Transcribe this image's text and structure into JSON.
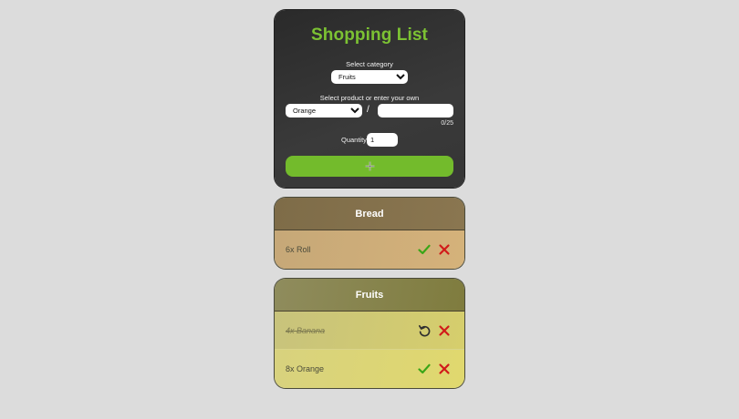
{
  "app": {
    "title": "Shopping List"
  },
  "form": {
    "category_label": "Select category",
    "category_selected": "Fruits",
    "product_label": "Select product or enter your own",
    "product_selected": "Orange",
    "separator": "/",
    "custom_product_value": "",
    "char_count": "0/25",
    "quantity_label": "Quantity",
    "quantity_value": "1",
    "add_button_icon": "plus-icon"
  },
  "categories": [
    {
      "name": "Bread",
      "items": [
        {
          "text": "6x Roll",
          "done": false,
          "actions": [
            "check-icon",
            "close-icon"
          ]
        }
      ]
    },
    {
      "name": "Fruits",
      "items": [
        {
          "text": "4x Banana",
          "done": true,
          "actions": [
            "undo-icon",
            "close-icon"
          ]
        },
        {
          "text": "8x Orange",
          "done": false,
          "actions": [
            "check-icon",
            "close-icon"
          ]
        }
      ]
    }
  ],
  "colors": {
    "accent_green": "#73bb2c",
    "title_green": "#7cc233",
    "check_green": "#3aa517",
    "delete_red": "#d11a1a",
    "form_bg": "#2f2f2f",
    "page_bg": "#dcdcdc"
  }
}
